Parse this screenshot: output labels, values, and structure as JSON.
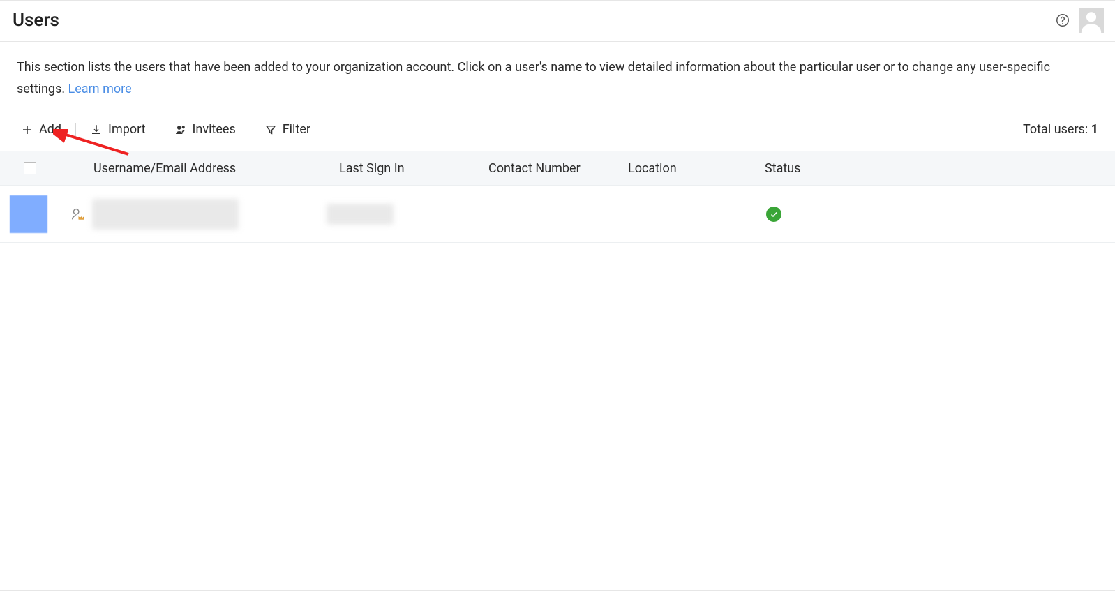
{
  "header": {
    "title": "Users"
  },
  "description": {
    "text": "This section lists the users that have been added to your organization account. Click on a user's name to view detailed information about the particular user or to change any user-specific settings.",
    "learn_more_label": "Learn more"
  },
  "toolbar": {
    "add_label": "Add",
    "import_label": "Import",
    "invitees_label": "Invitees",
    "filter_label": "Filter",
    "total_label": "Total users:",
    "total_count": "1"
  },
  "table": {
    "columns": {
      "username": "Username/Email Address",
      "last_signin": "Last Sign In",
      "contact": "Contact Number",
      "location": "Location",
      "status": "Status"
    },
    "rows": [
      {
        "username": "",
        "last_signin": "",
        "contact": "",
        "location": "",
        "status": "active"
      }
    ]
  }
}
